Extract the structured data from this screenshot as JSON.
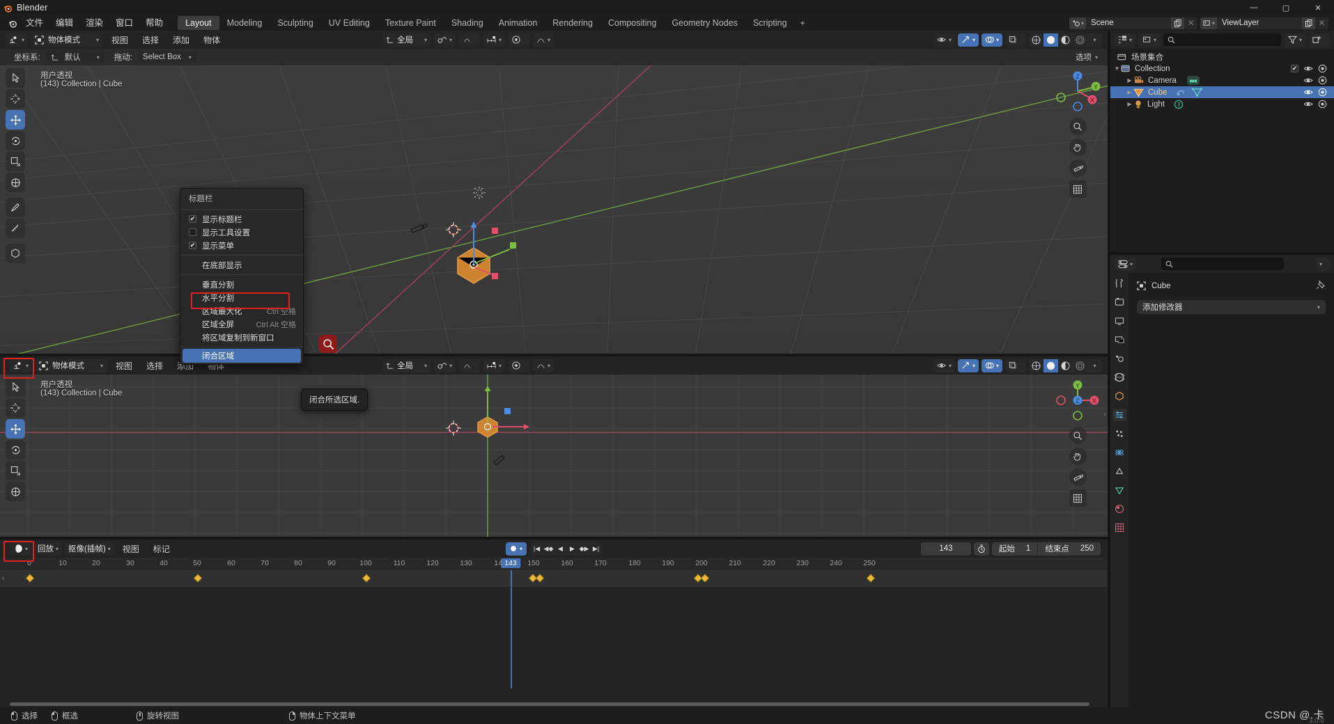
{
  "window": {
    "title": "Blender",
    "minimize": "—",
    "maximize": "▢",
    "close": "✕"
  },
  "topbar": {
    "menus": [
      "文件",
      "编辑",
      "渲染",
      "窗口",
      "帮助"
    ],
    "workspaces": [
      "Layout",
      "Modeling",
      "Sculpting",
      "UV Editing",
      "Texture Paint",
      "Shading",
      "Animation",
      "Rendering",
      "Compositing",
      "Geometry Nodes",
      "Scripting"
    ],
    "active_workspace": "Layout",
    "add_workspace": "+",
    "scene": {
      "label": "Scene",
      "icon": "scene-icon",
      "duplicate": "duplicate-icon",
      "unlink": "✕"
    },
    "viewlayer": {
      "label": "ViewLayer",
      "icon": "viewlayer-icon",
      "duplicate": "duplicate-icon",
      "unlink": "✕"
    }
  },
  "viewport_top": {
    "mode": "物体模式",
    "menus": [
      "视图",
      "选择",
      "添加",
      "物体"
    ],
    "transform_orientation_label": "坐标系:",
    "transform_orientation_value": "默认",
    "drag_label": "拖动:",
    "drag_value": "Select Box",
    "options_label": "选项",
    "global_label": "全局",
    "overlay_text_line1": "用户透视",
    "overlay_text_line2": "(143) Collection | Cube",
    "gizmo_axes": {
      "x": "X",
      "y": "Y",
      "z": "Z"
    }
  },
  "viewport_bottom": {
    "mode": "物体模式",
    "menus": [
      "视图",
      "选择",
      "添加",
      "物体"
    ],
    "global_label": "全局",
    "overlay_text_line1": "用户透视",
    "overlay_text_line2": "(143) Collection | Cube",
    "gizmo_axes": {
      "x": "X",
      "y": "Y",
      "z": "Z"
    }
  },
  "context_menu": {
    "title": "标题栏",
    "items": [
      {
        "label": "显示标题栏",
        "checkbox": true,
        "shortcut": ""
      },
      {
        "label": "显示工具设置",
        "checkbox": false,
        "shortcut": ""
      },
      {
        "label": "显示菜单",
        "checkbox": true,
        "shortcut": ""
      },
      {
        "label": "在底部显示",
        "checkbox": null,
        "shortcut": ""
      },
      {
        "label": "垂直分割",
        "checkbox": null,
        "shortcut": ""
      },
      {
        "label": "水平分割",
        "checkbox": null,
        "shortcut": "",
        "highlight_box": true
      },
      {
        "label": "区域最大化",
        "checkbox": null,
        "shortcut": "Ctrl 空格"
      },
      {
        "label": "区域全屏",
        "checkbox": null,
        "shortcut": "Ctrl Alt 空格"
      },
      {
        "label": "将区域复制到新窗口",
        "checkbox": null,
        "shortcut": ""
      }
    ],
    "selected_item": "闭合区域",
    "tooltip": "闭合所选区域."
  },
  "outliner": {
    "display_mode_icon": "outliner-icon",
    "filter_icon": "filter-icon",
    "new_collection_icon": "new-collection-icon",
    "search_placeholder": "",
    "scene_collection": "场景集合",
    "rows": [
      {
        "label": "Collection",
        "icon": "collection-icon",
        "depth": 1,
        "selected": false,
        "checkbox": true
      },
      {
        "label": "Camera",
        "icon": "camera-icon",
        "depth": 2,
        "selected": false,
        "checkbox": false
      },
      {
        "label": "Cube",
        "icon": "mesh-icon",
        "depth": 2,
        "selected": true,
        "checkbox": false
      },
      {
        "label": "Light",
        "icon": "light-icon",
        "depth": 2,
        "selected": false,
        "checkbox": false
      }
    ]
  },
  "properties": {
    "editor_icon": "properties-icon",
    "search_placeholder": "",
    "breadcrumb": "Cube",
    "add_modifier": "添加修改器",
    "active_tab": "modifier"
  },
  "timeline": {
    "editor_icon": "timeline-icon",
    "menus": [
      "回放",
      "抠像(插帧)",
      "视图",
      "标记"
    ],
    "playback_label": "回放",
    "keying_label": "抠像(插帧)",
    "view_label": "视图",
    "marker_label": "标记",
    "current_frame": "143",
    "start_label": "起始",
    "start_value": "1",
    "end_label": "结束点",
    "end_value": "250",
    "ticks": [
      0,
      10,
      20,
      30,
      40,
      50,
      60,
      70,
      80,
      90,
      100,
      110,
      120,
      130,
      140,
      150,
      160,
      170,
      180,
      190,
      200,
      210,
      220,
      230,
      240,
      250
    ],
    "keyframes": [
      1,
      50,
      100,
      145,
      148,
      192,
      195,
      248
    ],
    "playhead_frame": 143,
    "playhead_badge": "143"
  },
  "statusbar": {
    "items": [
      {
        "icon": "mouse-left-icon",
        "label": "选择"
      },
      {
        "icon": "mouse-drag-icon",
        "label": "框选"
      },
      {
        "icon": "mouse-middle-icon",
        "label": "旋转视图"
      },
      {
        "icon": "mouse-right-icon",
        "label": "物体上下文菜单"
      }
    ],
    "watermark": "CSDN @.卡",
    "version": "3.0.0"
  },
  "colors": {
    "accent": "#4772b3",
    "highlight_red": "#e52020",
    "keyframe": "#e8b93c",
    "axis_x": "#e0506a",
    "axis_y": "#7dbd42",
    "axis_z": "#4b8ce0",
    "object_orange": "#e8b255"
  }
}
